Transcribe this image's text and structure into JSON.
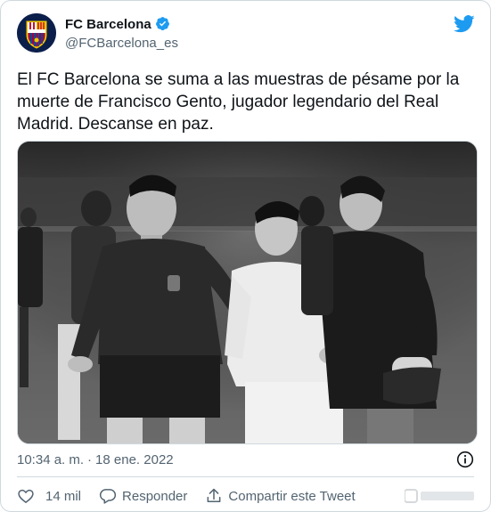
{
  "author": {
    "name": "FC Barcelona",
    "handle": "@FCBarcelona_es"
  },
  "tweet": {
    "text": "El FC Barcelona se suma a las muestras de pésame por la muerte de Francisco Gento, jugador legendario del Real Madrid. Descanse en paz.",
    "time": "10:34 a. m.",
    "separator": "·",
    "date": "18 ene. 2022"
  },
  "actions": {
    "likes": "14 mil",
    "reply_label": "Responder",
    "share_label": "Compartir este Tweet"
  },
  "colors": {
    "twitter_blue": "#1d9bf0",
    "secondary_text": "#536471",
    "border": "#cfd9de"
  },
  "icons": [
    "verified-badge-icon",
    "twitter-bird-icon",
    "info-icon",
    "heart-icon",
    "reply-icon",
    "share-icon"
  ]
}
